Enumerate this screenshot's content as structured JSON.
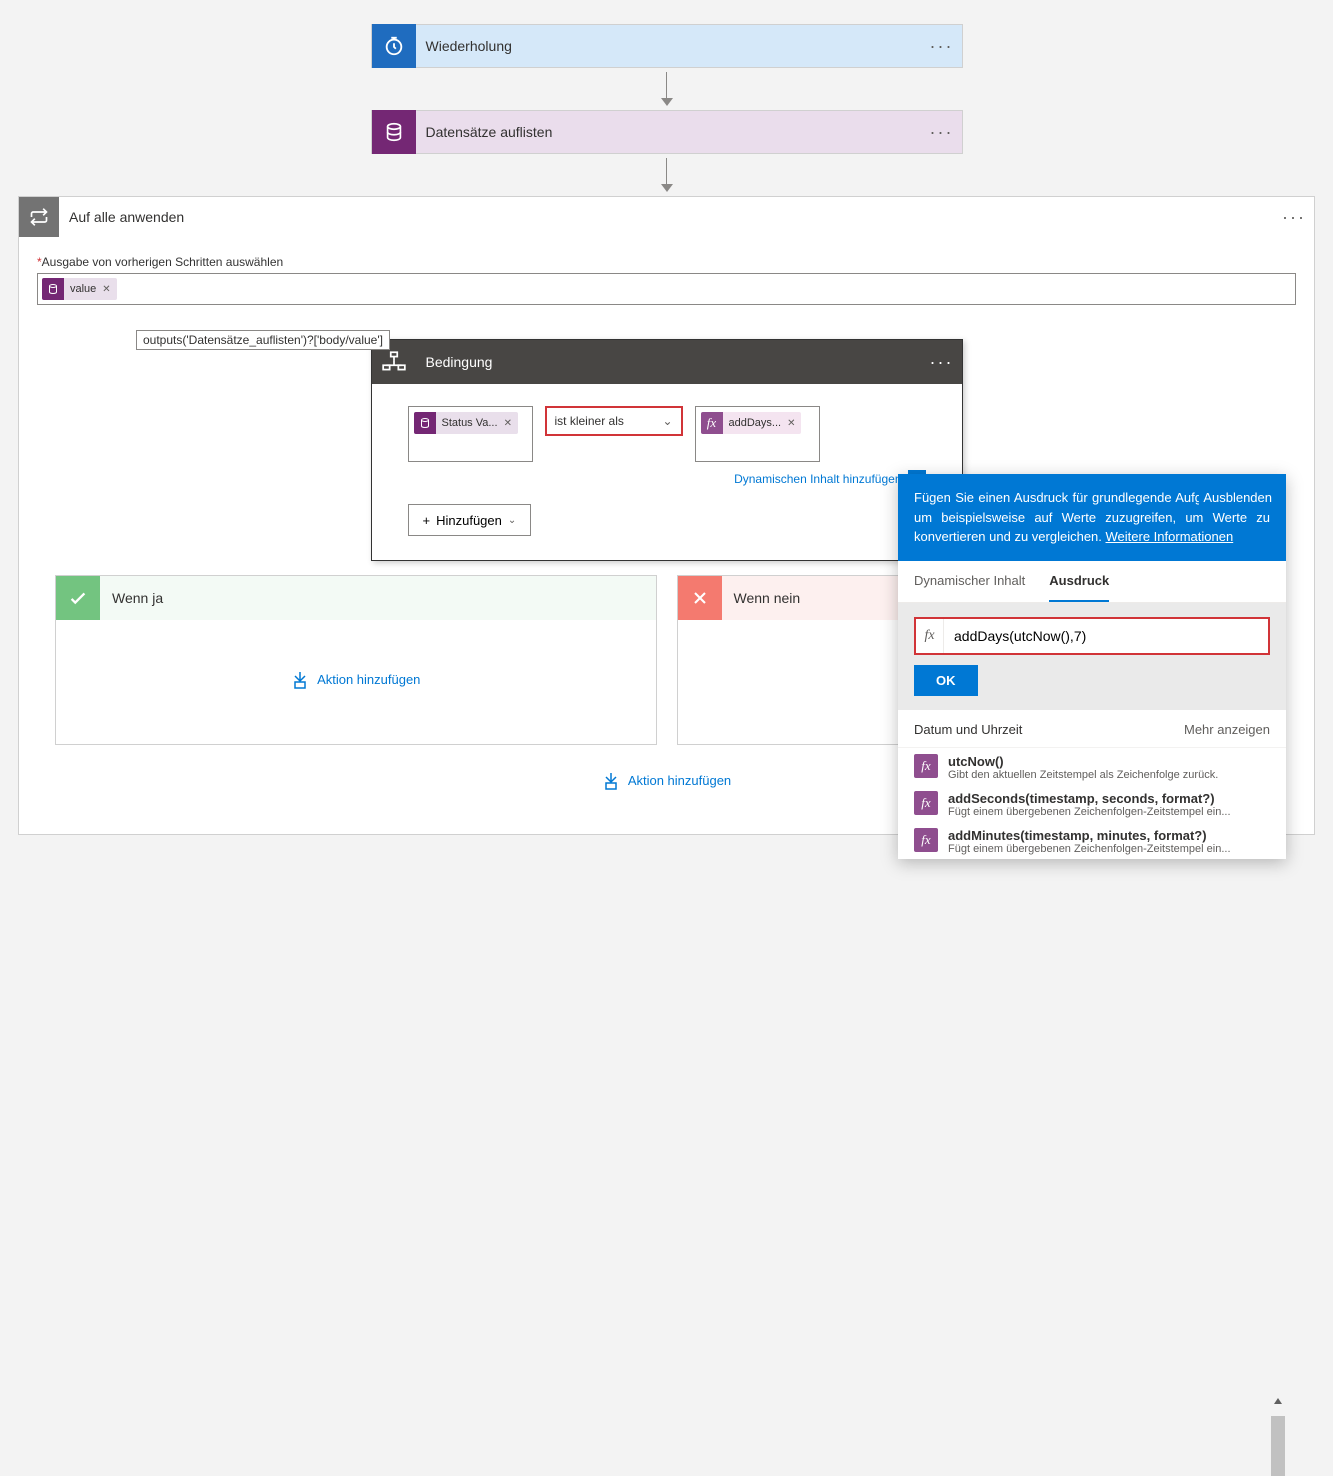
{
  "recurrence": {
    "title": "Wiederholung"
  },
  "list_records": {
    "title": "Datensätze auflisten"
  },
  "foreach": {
    "title": "Auf alle anwenden",
    "input_label": "Ausgabe von vorherigen Schritten auswählen",
    "token_label": "value",
    "tooltip": "outputs('Datensätze_auflisten')?['body/value']"
  },
  "condition": {
    "title": "Bedingung",
    "left_token": "Status Va...",
    "operator": "ist kleiner als",
    "right_token": "addDays...",
    "dyn_link": "Dynamischen Inhalt hinzufügen",
    "add_button": "Hinzufügen"
  },
  "branches": {
    "yes": "Wenn ja",
    "no": "Wenn nein",
    "add_action": "Aktion hinzufügen"
  },
  "main_add_action": "Aktion hinzufügen",
  "expr_panel": {
    "intro": "Fügen Sie einen Ausdruck für grundlegende Aufgaben hinzu, um beispielsweise auf Werte zuzugreifen, um Werte zu konvertieren und zu vergleichen.",
    "learn_more": "Weitere Informationen",
    "hide": "Ausblenden",
    "tab_dynamic": "Dynamischer Inhalt",
    "tab_expression": "Ausdruck",
    "input_value": "addDays(utcNow(),7)",
    "ok": "OK",
    "category": "Datum und Uhrzeit",
    "more": "Mehr anzeigen",
    "items": [
      {
        "name": "utcNow()",
        "desc": "Gibt den aktuellen Zeitstempel als Zeichenfolge zurück."
      },
      {
        "name": "addSeconds(timestamp, seconds, format?)",
        "desc": "Fügt einem übergebenen Zeichenfolgen-Zeitstempel ein..."
      },
      {
        "name": "addMinutes(timestamp, minutes, format?)",
        "desc": "Fügt einem übergebenen Zeichenfolgen-Zeitstempel ein..."
      }
    ]
  }
}
